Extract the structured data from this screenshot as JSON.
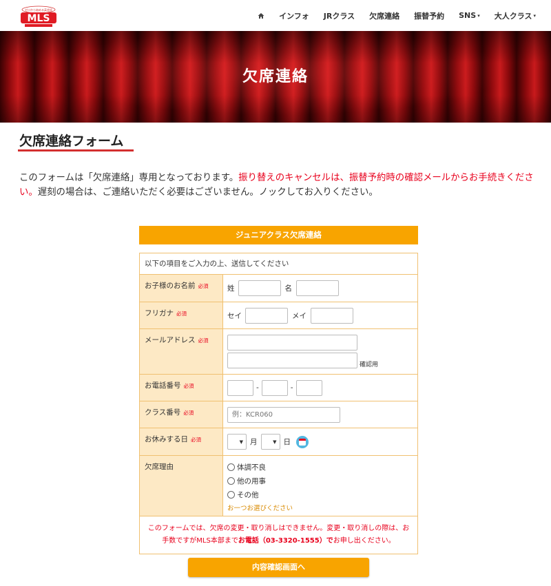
{
  "nav": {
    "logo_text": "MLS",
    "logo_sub": "ゼロから始める英会話",
    "home_icon": "home-icon",
    "items": [
      {
        "label": "インフォ"
      },
      {
        "label": "JRクラス"
      },
      {
        "label": "欠席連絡"
      },
      {
        "label": "振替予約"
      },
      {
        "label": "SNS",
        "caret": "▾"
      },
      {
        "label": "大人クラス",
        "caret": "▾"
      }
    ]
  },
  "hero": {
    "title": "欠席連絡"
  },
  "section": {
    "title": "欠席連絡フォーム",
    "intro_1": "このフォームは「欠席連絡」専用となっております。",
    "intro_red": "振り替えのキャンセルは、振替予約時の確認メールからお手続きください。",
    "intro_2": "遅刻の場合は、ご連絡いただく必要はございません。ノックしてお入りください。"
  },
  "form": {
    "header": "ジュニアクラス欠席連絡",
    "intro": "以下の項目をご入力の上、送信してください",
    "required": "必須",
    "name": {
      "label": "お子様のお名前",
      "last": "姓",
      "first": "名"
    },
    "kana": {
      "label": "フリガナ",
      "last": "セイ",
      "first": "メイ"
    },
    "email": {
      "label": "メールアドレス",
      "confirm": "確認用"
    },
    "phone": {
      "label": "お電話番号",
      "sep": "-"
    },
    "class": {
      "label": "クラス番号",
      "placeholder": "例：KCR060"
    },
    "date": {
      "label": "お休みする日",
      "month": "月",
      "day": "日"
    },
    "reason": {
      "label": "欠席理由",
      "options": [
        "体調不良",
        "他の用事",
        "その他"
      ],
      "note": "お一つお選びください"
    },
    "notice_1": "このフォームでは、欠席の変更・取り消しはできません。変更・取り消しの際は、お手数ですがMLS本部まで",
    "notice_bold": "お電話（03-3320-1555）で",
    "notice_2": "お申し出ください。",
    "submit": "内容確認画面へ"
  },
  "colors": {
    "accent": "#f8a400",
    "red": "#e8001c",
    "label_bg": "#fde9c5"
  }
}
